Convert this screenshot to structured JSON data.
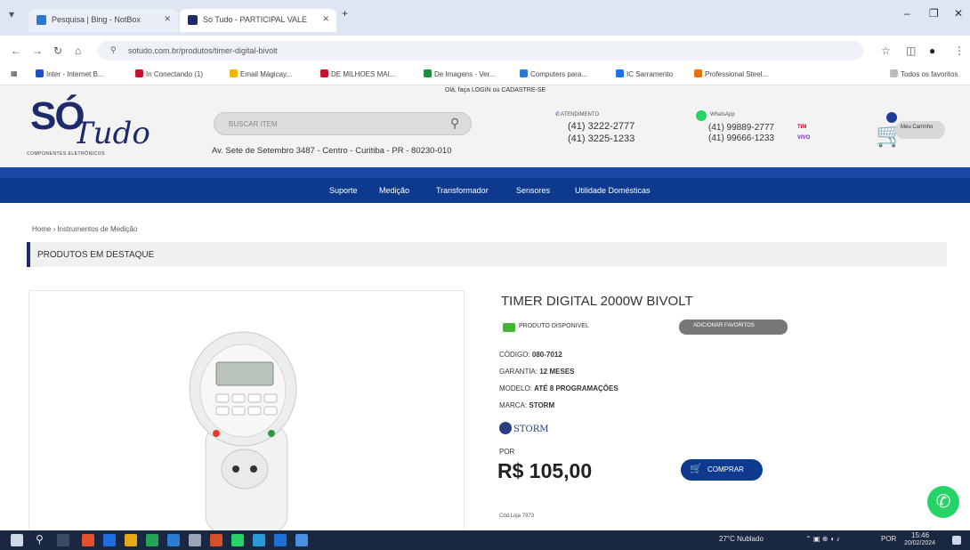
{
  "browser": {
    "tabs": [
      {
        "label": "Pesquisa | Bing - NotBox",
        "active": false
      },
      {
        "label": "Só Tudo - PARTICIPAL VALE",
        "active": true
      }
    ],
    "new_tab_icon": "plus-icon",
    "url": "sotudo.com.br/produtos/timer-digital-bivolt",
    "bookmarks": [
      "Inter - Internet B...",
      "In Conectando (1)",
      "Email Mágicay...",
      "DE MILHOES MAI...",
      "De Imagens - Ver...",
      "Computers para...",
      "IC Sarramento",
      "Professional Steel..."
    ],
    "bookmarks_right": "Todos os favoritos"
  },
  "site": {
    "login_hint": "Olá, faça LOGIN ou CADASTRE-SE",
    "logo_so": "SÓ",
    "logo_tudo": "Tudo",
    "logo_tagline": "COMPONENTES ELETRÔNICOS",
    "search_placeholder": "BUSCAR ITEM",
    "address": "Av. Sete de Setembro 3487 - Centro - Curitiba - PR - 80230-010",
    "phone_label": "ATENDIMENTO",
    "phone_1": "(41) 3222-2777",
    "phone_2": "(41) 3225-1233",
    "whatsapp_label": "WhatsApp",
    "whatsapp_1": "(41) 99889-2777",
    "whatsapp_2": "(41) 99666-1233",
    "tim_badge": "TIM",
    "vivo_badge": "VIVO",
    "cart_label": "Meu Carrinho",
    "nav_items": [
      "Suporte",
      "Medição",
      "Transformador",
      "Sensores",
      "Utilidade Domésticas"
    ]
  },
  "page": {
    "breadcrumb": "Home › Instrumentos de Medição",
    "section_title": "PRODUTOS EM DESTAQUE",
    "product": {
      "title": "TIMER DIGITAL 2000W BIVOLT",
      "stock": "PRODUTO DISPONIVEL",
      "wishlist": "ADICIONAR FAVORITOS",
      "code_label": "CÓDIGO:",
      "code": "080-7012",
      "warranty_label": "GARANTIA:",
      "warranty": "12 MESES",
      "model_label": "MODELO:",
      "model": "ATÉ 8 PROGRAMAÇÕES",
      "brand_label": "MARCA:",
      "brand": "STORM",
      "brand_logo_text": "STORM",
      "price_prefix": "POR",
      "price": "R$ 105,00",
      "buy_label": "COMPRAR",
      "code_strip": "Cód.Loja 7973"
    }
  },
  "taskbar": {
    "weather": "27°C  Nublado",
    "time": "15:46",
    "date": "20/02/2024",
    "lang": "POR"
  }
}
